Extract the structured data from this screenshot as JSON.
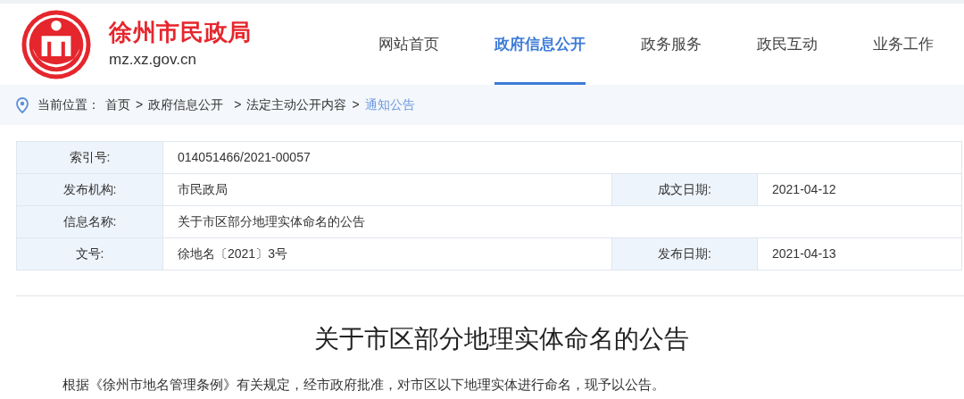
{
  "site": {
    "name": "徐州市民政局",
    "domain": "mz.xz.gov.cn"
  },
  "nav": [
    {
      "label": "网站首页",
      "selected": false
    },
    {
      "label": "政府信息公开",
      "selected": true
    },
    {
      "label": "政务服务",
      "selected": false
    },
    {
      "label": "政民互动",
      "selected": false
    },
    {
      "label": "业务工作",
      "selected": false
    }
  ],
  "breadcrumb": {
    "prefix": "当前位置：",
    "separator": ">",
    "items": [
      {
        "label": "首页",
        "selected": false
      },
      {
        "label": "政府信息公开",
        "selected": false
      },
      {
        "label": "法定主动公开内容",
        "selected": false
      },
      {
        "label": "通知公告",
        "selected": true
      }
    ]
  },
  "info_table": [
    [
      {
        "label": "索引号:",
        "value": "014051466/2021-00057"
      }
    ],
    [
      {
        "label": "发布机构:",
        "value": "市民政局"
      },
      {
        "label": "成文日期:",
        "value": "2021-04-12"
      }
    ],
    [
      {
        "label": "信息名称:",
        "value": "关于市区部分地理实体命名的公告"
      }
    ],
    [
      {
        "label": "文号:",
        "value": "徐地名〔2021〕3号"
      },
      {
        "label": "发布日期:",
        "value": "2021-04-13"
      }
    ]
  ],
  "article": {
    "title": "关于市区部分地理实体命名的公告",
    "body": "根据《徐州市地名管理条例》有关规定，经市政府批准，对市区以下地理实体进行命名，现予以公告。"
  }
}
